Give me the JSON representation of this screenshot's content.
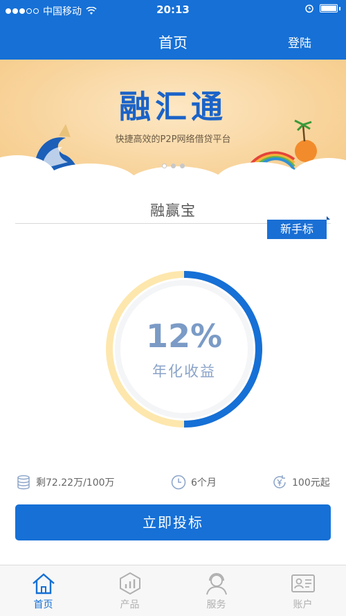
{
  "status_bar": {
    "carrier": "中国移动",
    "time": "20:13"
  },
  "nav": {
    "title": "首页",
    "login": "登陆"
  },
  "banner": {
    "logo_text": "融汇通",
    "tagline": "快捷高效的P2P网络借贷平台",
    "pager": {
      "count": 3,
      "active_index": 0
    }
  },
  "product": {
    "name": "融赢宝",
    "badge": "新手标",
    "rate_percent": "12%",
    "rate_label": "年化收益",
    "progress_fraction": 0.5,
    "remaining": "剩72.22万/100万",
    "term": "6个月",
    "min_amount": "100元起",
    "cta": "立即投标"
  },
  "tabs": [
    {
      "label": "首页",
      "icon": "home-icon",
      "active": true
    },
    {
      "label": "产品",
      "icon": "product-chart-icon",
      "active": false
    },
    {
      "label": "服务",
      "icon": "service-agent-icon",
      "active": false
    },
    {
      "label": "账户",
      "icon": "account-card-icon",
      "active": false
    }
  ],
  "colors": {
    "primary": "#1670d6",
    "ring_remaining": "#fde7ad",
    "rate_text": "#7b9bc6"
  }
}
